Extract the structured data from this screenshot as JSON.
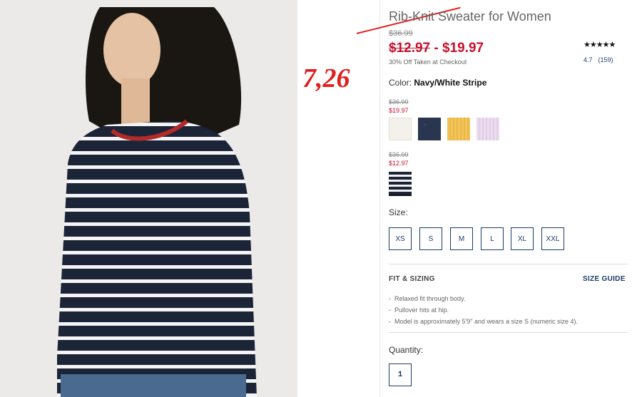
{
  "product": {
    "title": "Rib-Knit Sweater for Women",
    "original_price": "$36.99",
    "sale_price_old": "$12.97",
    "sale_price_sep": " - ",
    "sale_price_high": "$19.97",
    "discount_note": "30% Off Taken at Checkout",
    "stars_glyph": "★★★★★",
    "rating_value": "4.7",
    "rating_count": "(159)"
  },
  "annotation": {
    "text": "7,26",
    "color": "#e02020"
  },
  "color": {
    "label": "Color:",
    "selected": "Navy/White Stripe",
    "groups": [
      {
        "original": "$36.99",
        "sale": "$19.97",
        "swatches": [
          "cream",
          "navy-heather",
          "yellow",
          "lavender"
        ]
      },
      {
        "original": "$36.99",
        "sale": "$12.97",
        "swatches": [
          "navy-white-stripe"
        ]
      }
    ],
    "swatch_colors": {
      "cream": "#f3f1ea",
      "navy-heather": "#2a3550",
      "yellow": "#f2c45a",
      "lavender": "#ecdcef"
    }
  },
  "size": {
    "label": "Size:",
    "options": [
      "XS",
      "S",
      "M",
      "L",
      "XL",
      "XXL"
    ]
  },
  "fit": {
    "title": "FIT & SIZING",
    "guide_link": "SIZE GUIDE",
    "items": [
      "Relaxed fit through body.",
      "Pullover hits at hip.",
      "Model is approximately 5'9\" and wears a size S (numeric size 4)."
    ]
  },
  "quantity": {
    "label": "Quantity:",
    "value": "1"
  },
  "colors": {
    "accent": "#1e3b6a",
    "sale_red": "#c8102e",
    "annotation_red": "#e02020"
  }
}
